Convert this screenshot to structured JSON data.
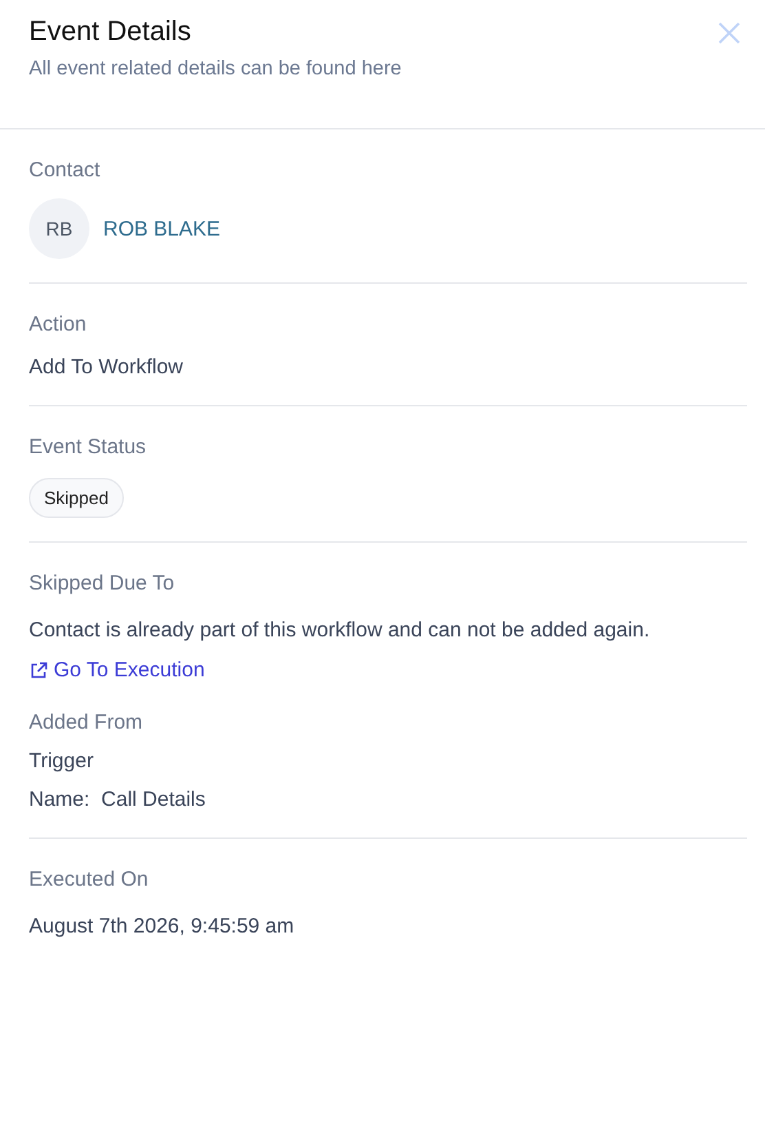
{
  "header": {
    "title": "Event Details",
    "subtitle": "All event related details can be found here"
  },
  "contact": {
    "label": "Contact",
    "initials": "RB",
    "name": "ROB BLAKE"
  },
  "action": {
    "label": "Action",
    "value": "Add To Workflow"
  },
  "event_status": {
    "label": "Event Status",
    "badge": "Skipped"
  },
  "skipped_due_to": {
    "label": "Skipped Due To",
    "reason": "Contact is already part of this workflow and can not be added again.",
    "link": "Go To Execution"
  },
  "added_from": {
    "label": "Added From",
    "source": "Trigger",
    "name_label": "Name:",
    "name_value": "Call Details"
  },
  "executed_on": {
    "label": "Executed On",
    "value": "August 7th 2026, 9:45:59 am"
  }
}
